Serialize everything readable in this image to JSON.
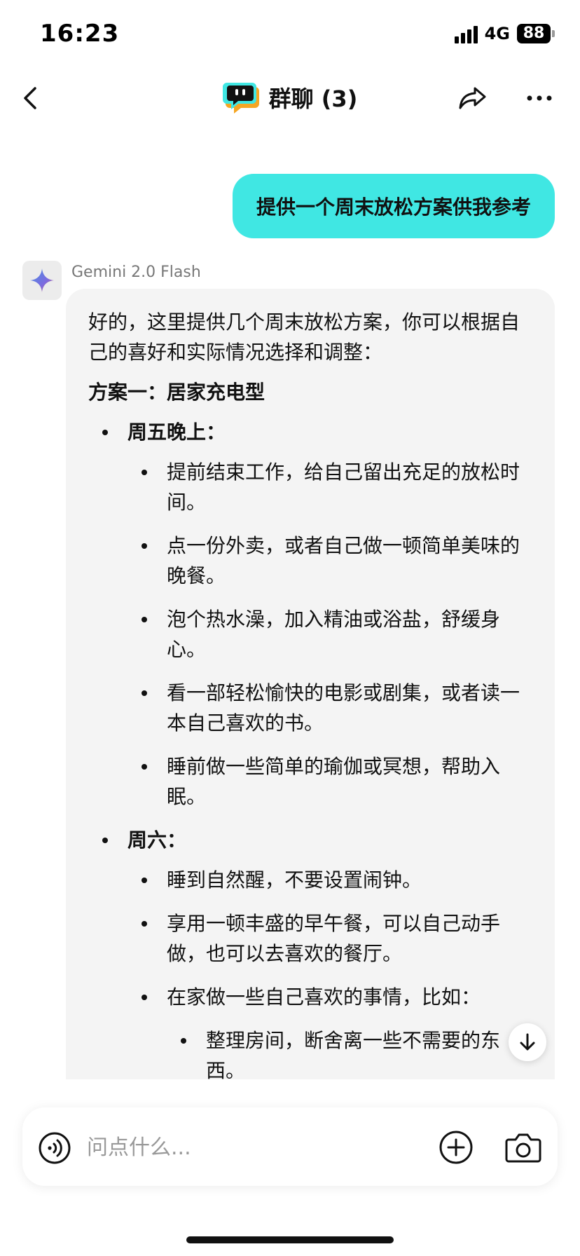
{
  "status_bar": {
    "time": "16:23",
    "network": "4G",
    "battery": "88"
  },
  "nav": {
    "title": "群聊 (3)",
    "back_icon": "chevron-left-icon",
    "logo_icon": "chat-bubble-logo-icon",
    "share_icon": "share-icon",
    "more_icon": "more-dots-icon",
    "colors": {
      "logo_cyan": "#40e7e3",
      "logo_orange": "#f5a623"
    }
  },
  "conversation": {
    "user_message": "提供一个周末放松方案供我参考",
    "user_bubble_color": "#40e7e3",
    "bot": {
      "name": "Gemini 2.0 Flash",
      "avatar_icon": "gemini-sparkle-icon",
      "intro": "好的，这里提供几个周末放松方案，你可以根据自己的喜好和实际情况选择和调整：",
      "plan_title": "方案一：居家充电型",
      "sections": [
        {
          "label": "周五晚上：",
          "items": [
            "提前结束工作，给自己留出充足的放松时间。",
            "点一份外卖，或者自己做一顿简单美味的晚餐。",
            "泡个热水澡，加入精油或浴盐，舒缓身心。",
            "看一部轻松愉快的电影或剧集，或者读一本自己喜欢的书。",
            "睡前做一些简单的瑜伽或冥想，帮助入眠。"
          ]
        },
        {
          "label": "周六：",
          "items": [
            "睡到自然醒，不要设置闹钟。",
            "享用一顿丰盛的早午餐，可以自己动手做，也可以去喜欢的餐厅。",
            "在家做一些自己喜欢的事情，比如："
          ],
          "sub_items": [
            "整理房间，断舍离一些不需要的东西。"
          ]
        }
      ]
    }
  },
  "scroll_button": {
    "icon": "arrow-down-icon"
  },
  "input": {
    "placeholder": "问点什么...",
    "value": "",
    "voice_icon": "voice-wave-icon",
    "add_icon": "plus-circle-icon",
    "camera_icon": "camera-icon"
  }
}
